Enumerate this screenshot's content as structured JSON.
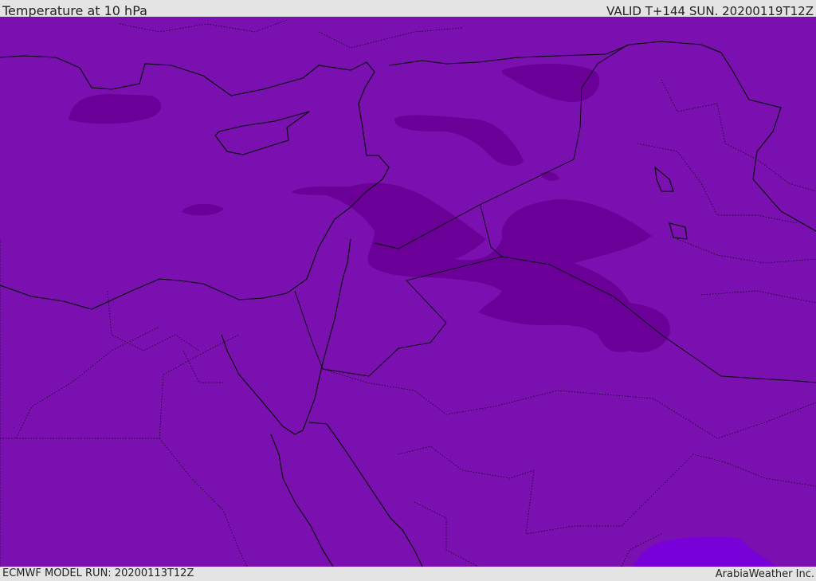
{
  "header": {
    "title": "Temperature at 10 hPa",
    "valid": "VALID T+144 SUN. 20200119T12Z"
  },
  "footer": {
    "model_run": "ECMWF MODEL RUN: 20200113T12Z",
    "brand": "ArabiaWeather Inc."
  },
  "colors": {
    "base_field": "#7a10b0",
    "cold_field": "#6a0098",
    "warm_field": "#7800d8",
    "coastline": "#000000",
    "background": "#e4e4e4"
  }
}
